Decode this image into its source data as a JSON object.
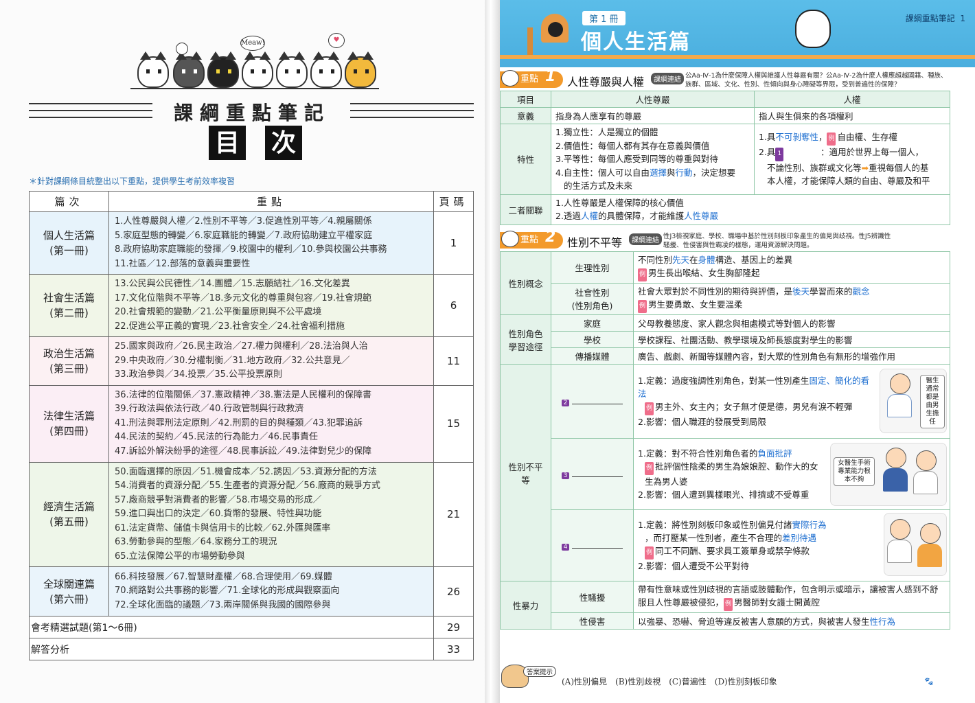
{
  "left": {
    "cat_bubble": "Meaw!",
    "title": "課綱重點筆記",
    "toc_chars": [
      "目",
      "次"
    ],
    "note": "＊針對課綱條目統整出以下重點，提供學生考前效率複習",
    "columns": [
      "篇次",
      "重點",
      "頁碼"
    ],
    "rows": [
      {
        "part": "個人生活篇",
        "vol": "(第一冊)",
        "page": "1",
        "lines": [
          "1.人性尊嚴與人權／2.性別不平等／3.促進性別平等／4.親屬關係",
          "5.家庭型態的轉變／6.家庭職能的轉變／7.政府協助建立平權家庭",
          "8.政府協助家庭職能的發揮／9.校園中的權利／10.參與校園公共事務",
          "11.社區／12.部落的意義與重要性"
        ]
      },
      {
        "part": "社會生活篇",
        "vol": "(第二冊)",
        "page": "6",
        "lines": [
          "13.公民與公民德性／14.團體／15.志願結社／16.文化差異",
          "17.文化位階與不平等／18.多元文化的尊重與包容／19.社會規範",
          "20.社會規範的變動／21.公平衡量原則與不公平處境",
          "22.促進公平正義的實現／23.社會安全／24.社會福利措施"
        ]
      },
      {
        "part": "政治生活篇",
        "vol": "(第三冊)",
        "page": "11",
        "lines": [
          "25.國家與政府／26.民主政治／27.權力與權利／28.法治與人治",
          "29.中央政府／30.分權制衡／31.地方政府／32.公共意見／",
          "33.政治參與／34.投票／35.公平投票原則"
        ]
      },
      {
        "part": "法律生活篇",
        "vol": "(第四冊)",
        "page": "15",
        "lines": [
          "36.法律的位階關係／37.憲政精神／38.憲法是人民權利的保障書",
          "39.行政法與依法行政／40.行政管制與行政救濟",
          "41.刑法與罪刑法定原則／42.刑罰的目的與種類／43.犯罪追訴",
          "44.民法的契約／45.民法的行為能力／46.民事責任",
          "47.訴訟外解決紛爭的途徑／48.民事訴訟／49.法律對兒少的保障"
        ]
      },
      {
        "part": "經濟生活篇",
        "vol": "(第五冊)",
        "page": "21",
        "lines": [
          "50.面臨選擇的原因／51.機會成本／52.誘因／53.資源分配的方法",
          "54.消費者的資源分配／55.生產者的資源分配／56.廠商的競爭方式",
          "57.廠商競爭對消費者的影響／58.市場交易的形成／",
          "59.進口與出口的決定／60.貨幣的發展、特性與功能",
          "61.法定貨幣、儲值卡與信用卡的比較／62.外匯與匯率",
          "63.勞動參與的型態／64.家務分工的現況",
          "65.立法保障公平的市場勞動參與"
        ]
      },
      {
        "part": "全球關連篇",
        "vol": "(第六冊)",
        "page": "26",
        "lines": [
          "66.科技發展／67.智慧財產權／68.合理使用／69.媒體",
          "70.網路對公共事務的影響／71.全球化的形成與觀察面向",
          "72.全球化面臨的議題／73.兩岸關係與我國的國際參與"
        ]
      }
    ],
    "extra": [
      {
        "label": "會考精選試題(第1～6冊)",
        "page": "29"
      },
      {
        "label": "解答分析",
        "page": "33"
      }
    ]
  },
  "right": {
    "vol_tag": "第 1 冊",
    "vol_title": "個人生活篇",
    "running_head": "課綱重點筆記",
    "page_no": "1",
    "sec_label": "重點",
    "link_label": "課綱連結",
    "sec1": {
      "num": "1",
      "title": "人性尊嚴與人權",
      "link": "公Aa-Ⅳ-1為什麼保障人權與維護人性尊嚴有關？公Aa-Ⅳ-2為什麼人權應超越國籍、種族、族群、區域、文化、性別、性傾向與身心障礙等界限，受到普遍性的保障？",
      "h_item": "項目",
      "h_dignity": "人性尊嚴",
      "h_rights": "人權",
      "r_meaning": "意義",
      "dignity_meaning": "指身為人應享有的尊嚴",
      "rights_meaning": "指人與生俱來的各項權利",
      "r_feature": "特性",
      "dignity_features": [
        "1.獨立性：人是獨立的個體",
        "2.價值性：每個人都有其存在意義與價值",
        "3.平等性：每個人應受到同等的尊重與對待",
        "4.自主性：個人可以自由"
      ],
      "dig4_b1": "選擇",
      "dig4_mid": "與",
      "dig4_b2": "行動",
      "dig4_tail": "，決定想要",
      "dig4_line2": "的生活方式及未來",
      "rf1_a": "1.具",
      "rf1_b": "不可剝奪性",
      "rf1_c": "，",
      "rf1_ex": "例",
      "rf1_d": "自由權、生存權",
      "rf2_a": "2.具",
      "rf2_badge": "1",
      "rf2_b": "：適用於世界上每一個人，",
      "rf2_c": "不論性別、族群或文化等",
      "rf2_arrow": "➡",
      "rf2_d": "重視每個人的基",
      "rf2_e": "本人權，才能保障人類的自由、尊嚴及和平",
      "r_relation": "二者關聯",
      "rel1": "1.人性尊嚴是人權保障的核心價值",
      "rel2_a": "2.透過",
      "rel2_b": "人權",
      "rel2_c": "的具體保障，才能維護",
      "rel2_d": "人性尊嚴"
    },
    "sec2": {
      "num": "2",
      "title": "性別不平等",
      "link": "性J3檢視家庭、學校、職場中基於性別刻板印象產生的偏見與歧視。性J5辨識性騷擾、性侵害與性霸凌的樣態，運用資源解決問題。",
      "concept": "性別概念",
      "bio": "生理性別",
      "bio_a": "不同性別",
      "bio_b": "先天",
      "bio_c": "在",
      "bio_d": "身體",
      "bio_e": "構造、基因上的差異",
      "bio_ex": "男生長出喉結、女生胸部隆起",
      "soc": "社會性別",
      "soc2": "(性別角色)",
      "soc_a": "社會大眾對於不同性別的期待與評價，是",
      "soc_b": "後天",
      "soc_c": "學習而來的",
      "soc_d": "觀念",
      "soc_ex": "男生要勇敢、女生要溫柔",
      "role": "性別角色學習途徑",
      "family": "家庭",
      "family_t": "父母教養態度、家人觀念與相處模式等對個人的影響",
      "school": "學校",
      "school_t": "學校課程、社團活動、教學環境及師長態度對學生的影響",
      "media": "傳播媒體",
      "media_t": "廣告、戲劇、新聞等媒體內容，對大眾的性別角色有無形的增強作用",
      "ineq": "性別不平等",
      "b2": "2",
      "b3": "3",
      "b4": "4",
      "i2_a": "1.定義：過度強調性別角色，對某一性別產生",
      "i2_b": "固定、簡化的看法",
      "i2_ex": "男主外、女主內；女子無才便是德，男兒有淚不輕彈",
      "i2_c": "2.影響：個人職涯的發展受到局限",
      "i2_note": "醫生通常都是由男生擔任",
      "i3_a": "1.定義：對不符合性別角色者的",
      "i3_b": "負面批評",
      "i3_ex": "批評個性陰柔的男生為娘娘腔、動作大的女生為男人婆",
      "i3_c": "2.影響：個人遭到異樣眼光、排擠或不受尊重",
      "i3_note": "女醫生手術專業能力根本不夠",
      "i4_a": "1.定義：將性別刻板印象或性別偏見付諸",
      "i4_b": "實際行為",
      "i4_c": "，而打壓某一性別者，產生不合理的",
      "i4_d": "差別待遇",
      "i4_ex": "同工不同酬、要求員工簽單身或禁孕條款",
      "i4_e": "2.影響：個人遭受不公平對待",
      "violence": "性暴力",
      "harass": "性騷擾",
      "harass_t1": "帶有性意味或性別歧視的言語或肢體動作，包含明示或暗示，讓被害人感到不舒服且人性尊嚴被侵犯，",
      "harass_ex": "男醫師對女護士開黃腔",
      "assault": "性侵害",
      "assault_a": "以強暴、恐嚇、脅迫等違反被害人意願的方式，與被害人發生",
      "assault_b": "性行為"
    },
    "answer_tag": "答案提示",
    "answer": "(A)性別偏見　(B)性別歧視　(C)普遍性　(D)性別刻板印象"
  }
}
